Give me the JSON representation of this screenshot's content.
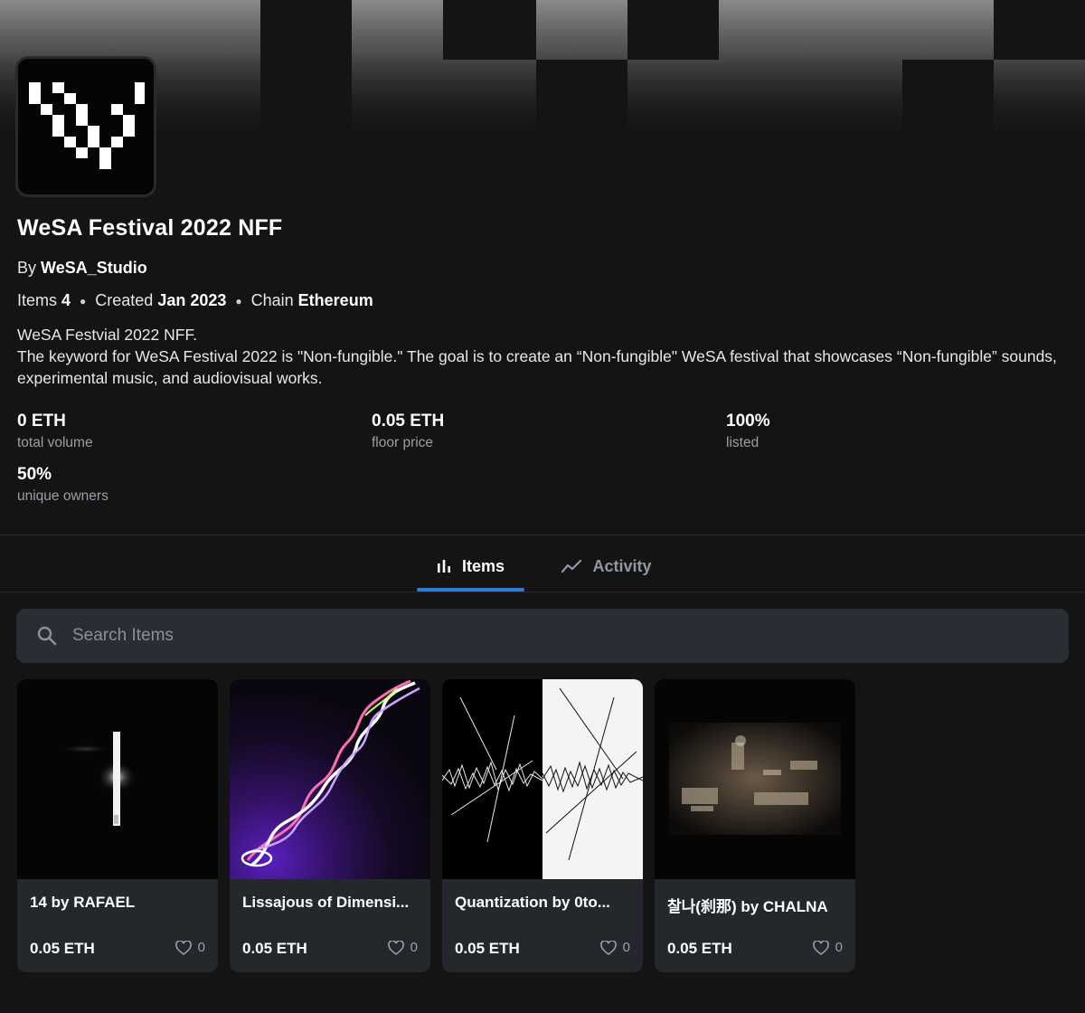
{
  "collection": {
    "title": "WeSA Festival 2022 NFF",
    "by_label": "By",
    "creator": "WeSA_Studio",
    "items_label": "Items",
    "items_count": "4",
    "created_label": "Created",
    "created_value": "Jan 2023",
    "chain_label": "Chain",
    "chain_value": "Ethereum",
    "description_line1": "WeSA Festvial 2022 NFF.",
    "description_line2": "The keyword for WeSA Festival 2022 is \"Non-fungible.\" The goal is to create an “Non-fungible\" WeSA festival that showcases “Non-fungible” sounds, experimental music, and audiovisual works."
  },
  "stats": [
    {
      "value": "0 ETH",
      "label": "total volume"
    },
    {
      "value": "0.05 ETH",
      "label": "floor price"
    },
    {
      "value": "100%",
      "label": "listed"
    },
    {
      "value": "50%",
      "label": "unique owners"
    }
  ],
  "tabs": [
    {
      "label": "Items",
      "icon": "bar-chart-icon",
      "active": true
    },
    {
      "label": "Activity",
      "icon": "trend-line-icon",
      "active": false
    }
  ],
  "search": {
    "placeholder": "Search Items",
    "value": "",
    "icon": "search-icon"
  },
  "items": [
    {
      "name": "14 by RAFAEL",
      "price": "0.05 ETH",
      "likes": "0"
    },
    {
      "name": "Lissajous of Dimensi...",
      "price": "0.05 ETH",
      "likes": "0"
    },
    {
      "name": "Quantization by 0to...",
      "price": "0.05 ETH",
      "likes": "0"
    },
    {
      "name": "찰나(刹那) by CHALNA",
      "price": "0.05 ETH",
      "likes": "0"
    }
  ],
  "colors": {
    "background": "#141414",
    "accent": "#2f7bdc",
    "card": "#24272c",
    "muted_text": "#9a9fa6"
  }
}
